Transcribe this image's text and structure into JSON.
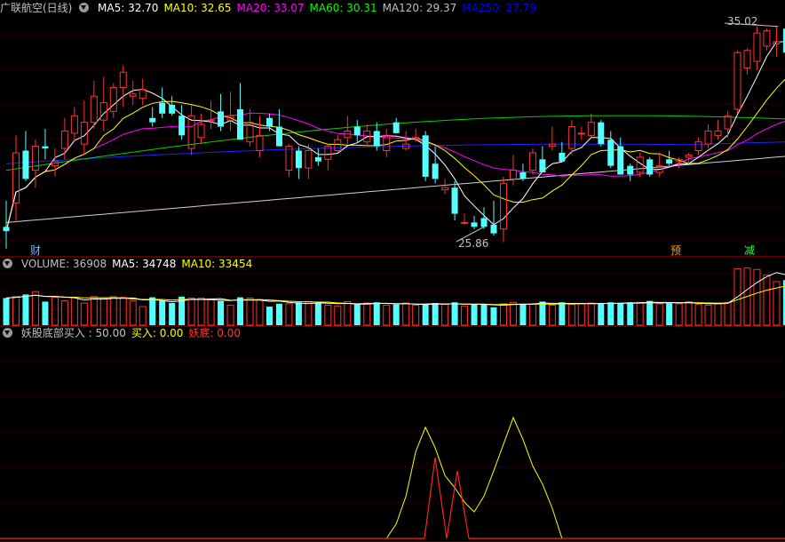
{
  "main_panel": {
    "title": "广联航空(日线)",
    "ma": [
      {
        "label": "MA5: 32.70",
        "color": "#ffffff"
      },
      {
        "label": "MA10: 32.65",
        "color": "#ffff00"
      },
      {
        "label": "MA20: 33.07",
        "color": "#ff00ff"
      },
      {
        "label": "MA60: 30.31",
        "color": "#00ff00"
      },
      {
        "label": "MA120: 29.37",
        "color": "#c0c0c0"
      },
      {
        "label": "MA250: 27.79",
        "color": "#0000ff"
      }
    ],
    "high_label": "35.02",
    "low_label": "25.86",
    "markers": [
      {
        "text": "财",
        "color": "#6fb7ff"
      },
      {
        "text": "预",
        "color": "#ff9900"
      },
      {
        "text": "减",
        "color": "#33ff33"
      }
    ]
  },
  "volume_panel": {
    "items": [
      {
        "label": "VOLUME: 36908",
        "color": "#c0c0c0"
      },
      {
        "label": "MA5: 34748",
        "color": "#ffffff"
      },
      {
        "label": "MA10: 33454",
        "color": "#ffff00"
      }
    ]
  },
  "indicator_panel": {
    "items": [
      {
        "label": "妖股底部买入 : 50.00",
        "color": "#c0c0c0"
      },
      {
        "label": "买入: 0.00",
        "color": "#ffff00"
      },
      {
        "label": "妖底: 0.00",
        "color": "#ff3030"
      }
    ]
  },
  "chart_data": {
    "type": "candlestick",
    "candles": [
      [
        25.8,
        27.0,
        24.8,
        25.6
      ],
      [
        26.9,
        30.0,
        26.0,
        29.2
      ],
      [
        29.3,
        30.2,
        27.9,
        28.0
      ],
      [
        28.4,
        29.8,
        27.6,
        29.5
      ],
      [
        29.5,
        30.3,
        28.9,
        29.4
      ],
      [
        28.6,
        29.4,
        28.1,
        28.8
      ],
      [
        29.4,
        30.8,
        28.9,
        30.2
      ],
      [
        30.1,
        31.3,
        29.7,
        30.9
      ],
      [
        29.6,
        31.6,
        29.1,
        30.6
      ],
      [
        30.6,
        32.5,
        30.3,
        31.8
      ],
      [
        30.7,
        32.7,
        30.2,
        31.5
      ],
      [
        31.1,
        32.4,
        30.8,
        32.2
      ],
      [
        32.2,
        33.2,
        31.3,
        32.9
      ],
      [
        31.8,
        32.5,
        31.4,
        31.9
      ],
      [
        31.7,
        32.6,
        31.4,
        32.1
      ],
      [
        30.8,
        31.3,
        30.4,
        30.6
      ],
      [
        31.5,
        32.2,
        30.8,
        31.0
      ],
      [
        31.4,
        31.8,
        30.9,
        31.0
      ],
      [
        30.9,
        31.4,
        29.8,
        30.0
      ],
      [
        29.4,
        31.4,
        29.1,
        30.9
      ],
      [
        29.9,
        31.0,
        29.6,
        30.5
      ],
      [
        30.7,
        31.6,
        30.3,
        30.7
      ],
      [
        31.1,
        31.9,
        30.2,
        30.4
      ],
      [
        30.7,
        32.0,
        30.2,
        30.9
      ],
      [
        31.2,
        32.4,
        29.8,
        29.8
      ],
      [
        29.7,
        31.2,
        29.5,
        30.6
      ],
      [
        29.3,
        30.9,
        29.0,
        30.0
      ],
      [
        30.8,
        31.0,
        30.2,
        30.4
      ],
      [
        30.4,
        31.2,
        29.5,
        29.5
      ],
      [
        28.4,
        29.6,
        28.1,
        29.5
      ],
      [
        29.3,
        29.5,
        28.0,
        28.5
      ],
      [
        28.5,
        29.6,
        28.0,
        29.3
      ],
      [
        29.0,
        29.4,
        28.6,
        28.8
      ],
      [
        28.9,
        29.6,
        28.4,
        29.5
      ],
      [
        29.3,
        30.0,
        29.2,
        29.8
      ],
      [
        29.9,
        30.9,
        29.6,
        30.2
      ],
      [
        30.4,
        30.7,
        29.7,
        30.0
      ],
      [
        29.7,
        30.5,
        29.5,
        30.2
      ],
      [
        30.2,
        30.6,
        29.3,
        29.5
      ],
      [
        29.3,
        30.3,
        29.0,
        30.0
      ],
      [
        30.6,
        30.8,
        30.1,
        30.1
      ],
      [
        29.4,
        30.2,
        29.3,
        29.6
      ],
      [
        29.9,
        30.3,
        29.7,
        29.9
      ],
      [
        30.0,
        30.2,
        27.9,
        28.1
      ],
      [
        28.7,
        29.5,
        27.8,
        28.0
      ],
      [
        27.5,
        28.0,
        27.3,
        27.6
      ],
      [
        27.6,
        27.9,
        26.1,
        26.4
      ],
      [
        26.0,
        26.4,
        25.9,
        26.0
      ],
      [
        26.0,
        26.3,
        25.7,
        25.8
      ],
      [
        26.2,
        26.7,
        25.7,
        25.8
      ],
      [
        25.9,
        27.0,
        25.4,
        25.5
      ],
      [
        25.7,
        28.1,
        25.1,
        27.8
      ],
      [
        28.0,
        29.1,
        27.7,
        28.4
      ],
      [
        28.3,
        28.7,
        27.9,
        28.0
      ],
      [
        28.4,
        29.4,
        28.2,
        29.2
      ],
      [
        28.9,
        29.5,
        28.3,
        28.3
      ],
      [
        29.5,
        30.4,
        29.3,
        29.6
      ],
      [
        29.2,
        29.7,
        28.8,
        28.8
      ],
      [
        29.4,
        30.7,
        29.1,
        30.4
      ],
      [
        30.1,
        30.4,
        29.8,
        30.1
      ],
      [
        30.0,
        31.0,
        29.9,
        30.6
      ],
      [
        30.6,
        30.7,
        29.5,
        29.6
      ],
      [
        29.8,
        30.2,
        28.5,
        28.6
      ],
      [
        29.5,
        29.9,
        28.2,
        28.2
      ],
      [
        28.6,
        28.7,
        27.9,
        28.2
      ],
      [
        28.3,
        29.2,
        28.1,
        29.0
      ],
      [
        28.9,
        29.0,
        28.1,
        28.2
      ],
      [
        28.3,
        29.2,
        28.1,
        28.6
      ],
      [
        28.9,
        29.3,
        28.6,
        28.7
      ],
      [
        28.8,
        29.0,
        28.5,
        28.9
      ],
      [
        29.0,
        29.2,
        28.7,
        29.1
      ],
      [
        29.3,
        29.9,
        29.1,
        29.7
      ],
      [
        29.6,
        30.5,
        29.4,
        30.2
      ],
      [
        30.0,
        30.7,
        29.8,
        30.2
      ],
      [
        30.3,
        31.1,
        29.9,
        30.9
      ],
      [
        31.2,
        33.9,
        31.0,
        33.8
      ],
      [
        33.1,
        34.0,
        32.8,
        33.9
      ],
      [
        33.4,
        35.0,
        33.0,
        34.7
      ],
      [
        34.1,
        34.9,
        33.9,
        34.8
      ],
      [
        34.2,
        35.0,
        33.6,
        34.3
      ],
      [
        34.9,
        35.0,
        33.8,
        33.8
      ],
      [
        33.7,
        34.6,
        33.5,
        34.2
      ],
      [
        34.1,
        34.4,
        33.9,
        34.0
      ],
      [
        33.9,
        34.5,
        33.4,
        34.3
      ],
      [
        34.1,
        34.4,
        33.6,
        33.8
      ],
      [
        33.7,
        34.3,
        33.3,
        33.8
      ],
      [
        33.8,
        34.5,
        33.6,
        34.2
      ],
      [
        34.3,
        35.0,
        34.0,
        34.6
      ],
      [
        34.6,
        34.8,
        33.5,
        34.0
      ]
    ],
    "volume": [
      3.8,
      4.0,
      4.3,
      4.7,
      3.3,
      3.9,
      3.4,
      3.9,
      3.1,
      4.0,
      3.8,
      4.0,
      3.9,
      3.4,
      2.6,
      3.9,
      3.4,
      3.1,
      4.0,
      3.8,
      3.8,
      3.6,
      3.4,
      2.8,
      3.9,
      3.8,
      3.6,
      2.6,
      3.0,
      3.0,
      3.2,
      3.3,
      3.1,
      2.8,
      2.7,
      3.3,
      2.9,
      3.1,
      3.2,
      2.8,
      2.9,
      3.1,
      2.8,
      2.9,
      3.1,
      2.9,
      3.2,
      2.7,
      2.9,
      2.9,
      2.5,
      3.0,
      3.2,
      3.0,
      3.0,
      3.3,
      2.8,
      3.2,
      2.9,
      3.0,
      3.1,
      3.0,
      3.2,
      3.1,
      3.2,
      3.2,
      3.4,
      3.0,
      3.1,
      3.0,
      3.3,
      2.9,
      2.8,
      3.0,
      3.2,
      7.9,
      8.0,
      7.8,
      7.0,
      6.1,
      6.3,
      7.4,
      7.0,
      6.4,
      5.6,
      5.0,
      5.0,
      4.6,
      4.5
    ],
    "indicator": {
      "buy": [
        0,
        0,
        0,
        0,
        0,
        0,
        0,
        0,
        0,
        0,
        0,
        0,
        0,
        0,
        0,
        0,
        0,
        0,
        0,
        0,
        0,
        0,
        0,
        0,
        0,
        0,
        0,
        0,
        0,
        0,
        0,
        0,
        0,
        0,
        0,
        0,
        0,
        0,
        0,
        0,
        0,
        0,
        0,
        0,
        0,
        0,
        0,
        12,
        35,
        72,
        92,
        75,
        52,
        42,
        30,
        22,
        35,
        56,
        78,
        100,
        82,
        60,
        45,
        25,
        0,
        0,
        0,
        0,
        0,
        0,
        0,
        0,
        0,
        0,
        0,
        0,
        0,
        0,
        0,
        0,
        0,
        0,
        0,
        0,
        0,
        0,
        0,
        0,
        0
      ],
      "yaodi": [
        0,
        0,
        0,
        0,
        0,
        0,
        0,
        0,
        0,
        0,
        0,
        0,
        0,
        0,
        0,
        0,
        0,
        0,
        0,
        0,
        0,
        0,
        0,
        0,
        0,
        0,
        0,
        0,
        0,
        0,
        0,
        0,
        0,
        0,
        0,
        0,
        0,
        0,
        0,
        0,
        0,
        0,
        0,
        0,
        0,
        0,
        0,
        0,
        0,
        0,
        0,
        0,
        0,
        0,
        0,
        0,
        0,
        0,
        0,
        0,
        0,
        0,
        0,
        0,
        0,
        0,
        0,
        0,
        0,
        0,
        0,
        0,
        0,
        0,
        0,
        0,
        0,
        0,
        0,
        0,
        0,
        0,
        0,
        0,
        0,
        0,
        0,
        0,
        0
      ]
    }
  }
}
